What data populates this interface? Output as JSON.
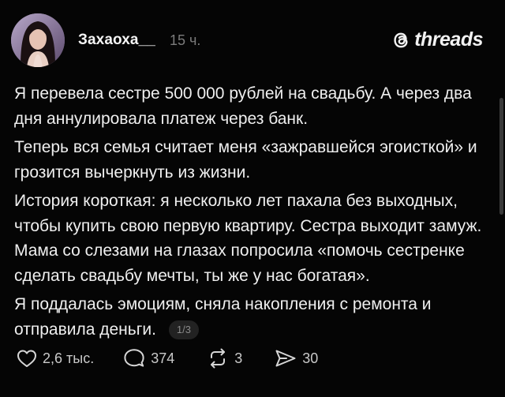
{
  "header": {
    "username": "Захаоха__",
    "time": "15 ч.",
    "brand": "threads",
    "brand_icon": "threads-logo-icon"
  },
  "post": {
    "paragraphs": [
      "Я перевела сестре 500 000 рублей на свадьбу. А через два дня аннулировала платеж через банк.",
      "Теперь вся семья считает меня «зажравшейся эгоисткой» и грозится вычеркнуть из жизни.",
      "История короткая: я несколько лет пахала без выходных, чтобы купить свою первую квартиру. Сестра выходит замуж. Мама со слезами на глазах попросила «помочь сестренке сделать свадьбу мечты, ты же у нас богатая».",
      "Я поддалась эмоциям, сняла накопления с ремонта и отправила деньги."
    ],
    "page_indicator": "1/3"
  },
  "actions": {
    "like_count": "2,6 тыс.",
    "reply_count": "374",
    "repost_count": "3",
    "share_count": "30",
    "icons": [
      "heart-icon",
      "comment-icon",
      "repost-icon",
      "share-icon"
    ]
  },
  "colors": {
    "background": "#050505",
    "text": "#efefef",
    "muted": "#7b7b7b"
  }
}
